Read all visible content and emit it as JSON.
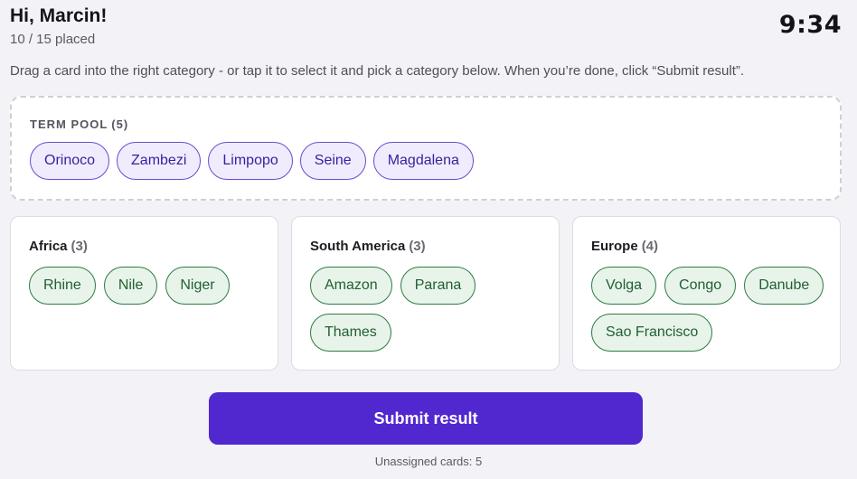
{
  "header": {
    "greeting": "Hi, Marcin!",
    "progress": "10 / 15 placed",
    "timer": "9:34"
  },
  "instructions": "Drag a card into the right category - or tap it to select it and pick a category below. When you’re done, click “Submit result”.",
  "pool": {
    "title": "TERM POOL",
    "count": "(5)",
    "cards": [
      "Orinoco",
      "Zambezi",
      "Limpopo",
      "Seine",
      "Magdalena"
    ]
  },
  "categories": [
    {
      "name": "Africa",
      "count": "(3)",
      "cards": [
        "Rhine",
        "Nile",
        "Niger"
      ]
    },
    {
      "name": "South America",
      "count": "(3)",
      "cards": [
        "Amazon",
        "Parana",
        "Thames"
      ]
    },
    {
      "name": "Europe",
      "count": "(4)",
      "cards": [
        "Volga",
        "Congo",
        "Danube",
        "Sao Francisco"
      ]
    }
  ],
  "submit_label": "Submit result",
  "unassigned": "Unassigned cards: 5",
  "colors": {
    "accent": "#5127d0",
    "pool_chip_border": "#6a4ccf",
    "placed_chip_border": "#2f7a43"
  }
}
